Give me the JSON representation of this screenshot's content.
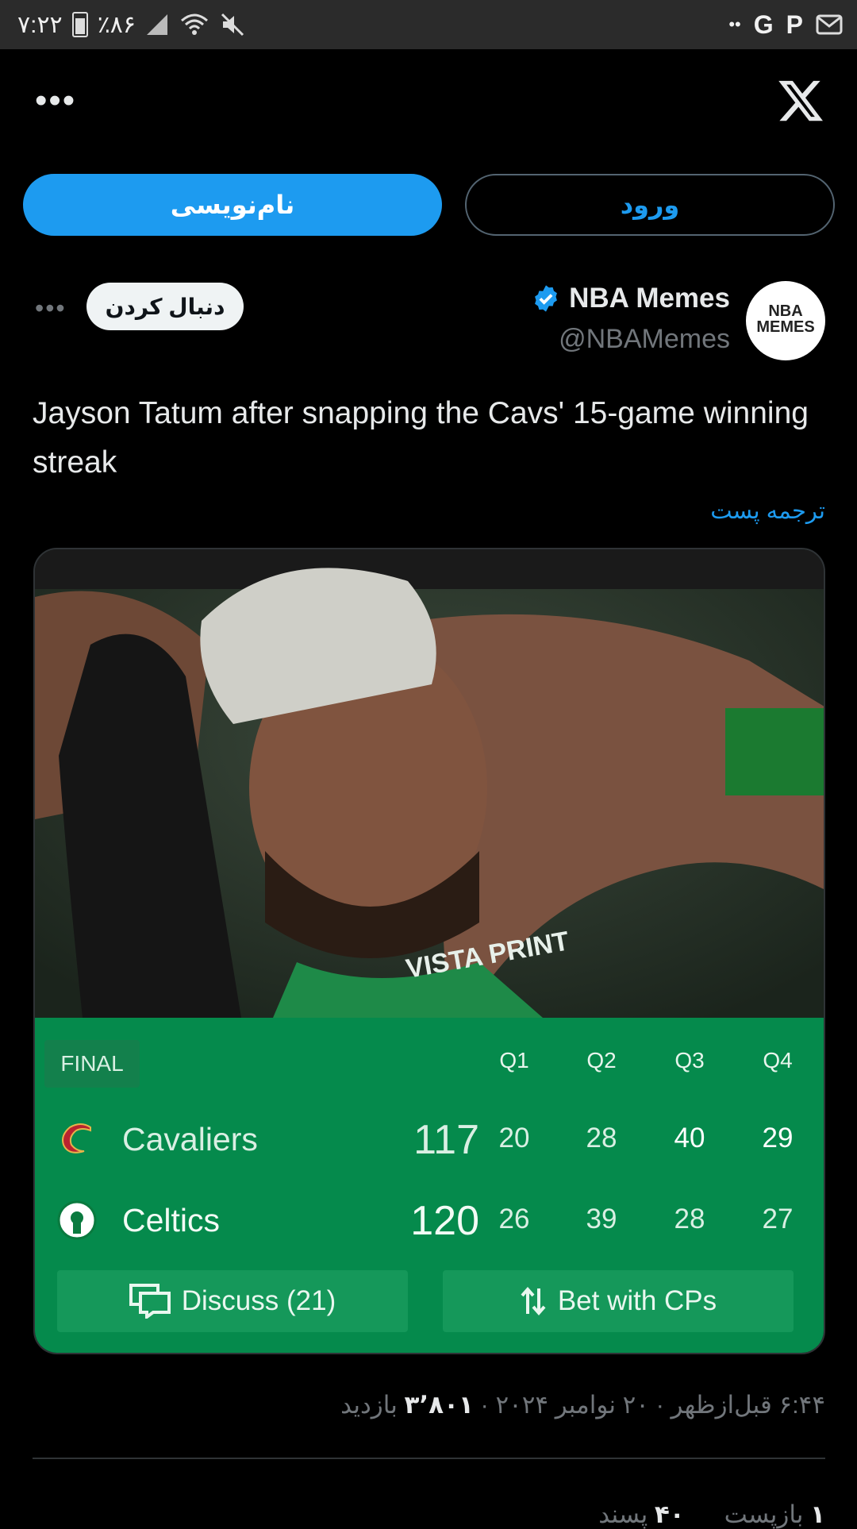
{
  "status_bar": {
    "time": "۷:۲۲",
    "battery": "٪۸۶",
    "right_icons": [
      "dots-icon",
      "google-icon",
      "p-icon",
      "mail-icon"
    ]
  },
  "nav": {
    "more": "•••",
    "logo": "x-logo-icon"
  },
  "auth": {
    "signup": "نام‌نویسی",
    "login": "ورود"
  },
  "author": {
    "name": "NBA Memes",
    "handle": "@NBAMemes",
    "avatar_text": "NBA MEMES",
    "follow": "دنبال کردن",
    "more": "•••"
  },
  "tweet": {
    "text": "Jayson Tatum after snapping the Cavs' 15-game winning streak",
    "translate": "ترجمه پست",
    "meta_prefix": "۶:۴۴ قبل‌ازظهر · ۲۰ نوامبر ۲۰۲۴ · ",
    "views": "۳٬۸۰۱",
    "views_label": " بازدید"
  },
  "scoreboard": {
    "status": "FINAL",
    "quarters": [
      "Q1",
      "Q2",
      "Q3",
      "Q4"
    ],
    "teams": [
      {
        "name": "Cavaliers",
        "total": "117",
        "q": [
          "20",
          "28",
          "40",
          "29"
        ]
      },
      {
        "name": "Celtics",
        "total": "120",
        "q": [
          "26",
          "39",
          "28",
          "27"
        ]
      }
    ],
    "discuss": "Discuss (21)",
    "bet": "Bet with CPs"
  },
  "jersey_text": "VISTA PRINT",
  "stats": {
    "reposts_num": "۱",
    "reposts_label": "بازپست",
    "likes_num": "۴۰",
    "likes_label": "پسند"
  },
  "colors": {
    "accent": "#1d9bf0",
    "board_green": "#058a4c"
  }
}
